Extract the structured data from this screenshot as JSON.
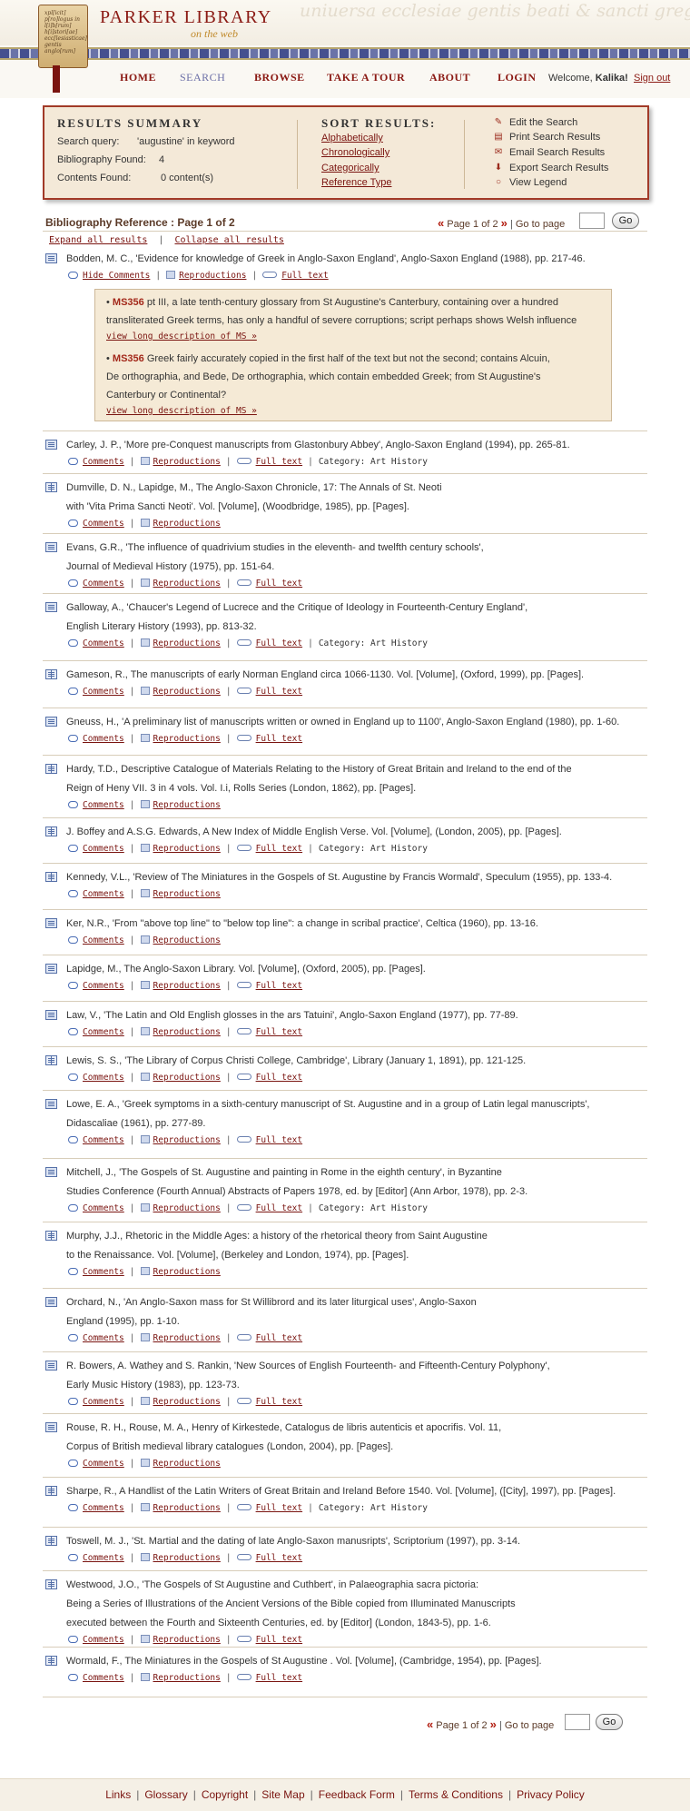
{
  "header": {
    "title": "PARKER LIBRARY",
    "subtitle": "on the web",
    "logo_text": "xpl[icit] p[ro]logus in l[i]b[rum] h[i]stori[ae] ecc[lesiasticae] gentis anglo[rum]",
    "background_script": "uniuersa ecclesiae gentis beati & sancti gregorii qui saeculis fecit scripsit sancta patrum dierum"
  },
  "nav": {
    "items": [
      "HOME",
      "SEARCH",
      "BROWSE",
      "TAKE A TOUR",
      "ABOUT",
      "LOGIN"
    ],
    "welcome_prefix": "Welcome,",
    "user": "Kalika!",
    "signout": "Sign out"
  },
  "summary": {
    "heading": "RESULTS SUMMARY",
    "query_label": "Search query:",
    "query_value": "'augustine' in keyword",
    "biblio_label": "Bibliography Found:",
    "biblio_value": "4",
    "contents_label": "Contents Found:",
    "contents_value": "0 content(s)",
    "sort_heading": "SORT RESULTS:",
    "sort_options": [
      "Alphabetically",
      "Chronologically",
      "Categorically",
      "Reference Type"
    ],
    "actions": [
      "Edit the Search",
      "Print Search Results",
      "Email Search Results",
      "Export Search Results",
      "View Legend"
    ]
  },
  "pager": {
    "title": "Bibliography Reference : Page 1 of 2",
    "page_text": "Page 1 of 2",
    "goto": "Go to page",
    "go": "Go",
    "prev": "«",
    "next": "»"
  },
  "expand": {
    "expand": "Expand all results",
    "collapse": "Collapse all results"
  },
  "link_labels": {
    "comments": "Comments",
    "hide_comments": "Hide Comments",
    "reproductions": "Reproductions",
    "fulltext": "Full text",
    "category_prefix": "Category:",
    "view_desc": "view long description of MS »"
  },
  "ms_items": [
    {
      "ms": "MS356",
      "text1": " pt III, a late tenth-century glossary from St Augustine's Canterbury, containing over a hundred",
      "text2": "transliterated Greek terms, has only a handful of severe corruptions; script perhaps shows Welsh influence"
    },
    {
      "ms": "MS356",
      "text1": " Greek fairly accurately copied in the first half of the text but not the second; contains Alcuin,",
      "text2": "De orthographia, and Bede, De orthographia, which contain embedded Greek; from St Augustine's",
      "text3": "Canterbury or Continental?"
    }
  ],
  "entries": [
    {
      "lines": [
        "Bodden, M. C.,  'Evidence for knowledge of Greek in Anglo-Saxon England', Anglo-Saxon England  (1988),  pp. 217-46."
      ],
      "fulltext": true,
      "category": "",
      "icon": "doc"
    },
    {
      "lines": [
        "Carley, J. P.,  'More pre-Conquest manuscripts from Glastonbury Abbey',  Anglo-Saxon  England  (1994),  pp. 265-81."
      ],
      "fulltext": true,
      "category": "Art History",
      "icon": "doc"
    },
    {
      "lines": [
        "Dumville, D. N.,  Lapidge, M.,  The Anglo-Saxon Chronicle, 17: The Annals of St. Neoti",
        "with 'Vita Prima Sancti Neoti'.   Vol. [Volume],  (Woodbridge,  1985),  pp. [Pages]."
      ],
      "fulltext": false,
      "category": "",
      "icon": "book"
    },
    {
      "lines": [
        "Evans, G.R.,  'The influence of quadrivium studies in the eleventh- and twelfth century schools',",
        "Journal of Medieval History  (1975),  pp. 151-64."
      ],
      "fulltext": true,
      "category": "",
      "icon": "doc"
    },
    {
      "lines": [
        "Galloway, A.,  'Chaucer's Legend of Lucrece and the Critique of Ideology in Fourteenth-Century  England',",
        "English Literary History  (1993),  pp. 813-32."
      ],
      "fulltext": true,
      "category": "Art History",
      "icon": "doc"
    },
    {
      "lines": [
        "Gameson, R.,  The manuscripts of early Norman England circa 1066-1130.   Vol. [Volume], (Oxford,  1999),  pp. [Pages]."
      ],
      "fulltext": true,
      "category": "",
      "icon": "book"
    },
    {
      "lines": [
        "Gneuss, H.,  'A preliminary list of manuscripts written or owned in England up to 1100',  Anglo-Saxon England  (1980),  pp. 1-60."
      ],
      "fulltext": true,
      "category": "",
      "icon": "doc"
    },
    {
      "lines": [
        "Hardy, T.D.,  Descriptive Catalogue of Materials Relating to the History of Great Britain and Ireland to the end of the",
        "Reign of Heny VII.   3 in 4 vols.   Vol. I.i,  Rolls Series  (London,  1862),  pp. [Pages]."
      ],
      "fulltext": false,
      "category": "",
      "icon": "book"
    },
    {
      "lines": [
        " J. Boffey and A.S.G. Edwards,  A New Index of Middle English Verse.   Vol. [Volume],  (London,  2005),  pp. [Pages]."
      ],
      "fulltext": true,
      "category": "Art History",
      "icon": "book"
    },
    {
      "lines": [
        "Kennedy, V.L.,  'Review of The Miniatures in the Gospels of St. Augustine by Francis Wormald', Speculum  (1955),  pp. 133-4."
      ],
      "fulltext": false,
      "category": "",
      "icon": "book"
    },
    {
      "lines": [
        "Ker, N.R.,  'From \"above top line\" to \"below top line\": a change in scribal practice',  Celtica  (1960),  pp. 13-16."
      ],
      "fulltext": false,
      "category": "",
      "icon": "doc"
    },
    {
      "lines": [
        "Lapidge, M.,  The Anglo-Saxon Library.   Vol. [Volume],  (Oxford,  2005),  pp. [Pages]."
      ],
      "fulltext": true,
      "category": "",
      "icon": "doc"
    },
    {
      "lines": [
        "Law, V.,  'The Latin and Old English glosses in the ars Tatuini',  Anglo-Saxon England  (1977),  pp. 77-89."
      ],
      "fulltext": true,
      "category": "",
      "icon": "doc"
    },
    {
      "lines": [
        "Lewis, S. S.,  'The Library of Corpus Christi College, Cambridge',  Library  (January 1, 1891),  pp. 121-125."
      ],
      "fulltext": true,
      "category": "",
      "icon": "book"
    },
    {
      "lines": [
        "Lowe, E. A.,  'Greek symptoms in a sixth-century manuscript of St. Augustine and in a group of Latin legal manuscripts',",
        "Didascaliae  (1961),  pp. 277-89."
      ],
      "fulltext": true,
      "category": "",
      "icon": "doc"
    },
    {
      "lines": [
        "Mitchell, J.,  'The Gospels of St. Augustine and painting in Rome in the eighth century',  in Byzantine",
        "Studies Conference (Fourth Annual) Abstracts of Papers 1978,  ed. by [Editor]  (Ann Arbor,  1978),  pp. 2-3."
      ],
      "fulltext": true,
      "category": "Art History",
      "icon": "doc"
    },
    {
      "lines": [
        "Murphy, J.J.,  Rhetoric in the Middle Ages: a history of the rhetorical theory from Saint Augustine",
        "to the Renaissance.   Vol. [Volume],  (Berkeley and London,  1974),  pp. [Pages]."
      ],
      "fulltext": false,
      "category": "",
      "icon": "book"
    },
    {
      "lines": [
        "Orchard, N.,  'An Anglo-Saxon mass for St Willibrord and its later liturgical uses',  Anglo-Saxon",
        "England  (1995),  pp. 1-10."
      ],
      "fulltext": true,
      "category": "",
      "icon": "doc"
    },
    {
      "lines": [
        "R. Bowers, A. Wathey and S. Rankin,  'New Sources of English Fourteenth- and Fifteenth-Century Polyphony',",
        "Early Music History  (1983),  pp. 123-73."
      ],
      "fulltext": true,
      "category": "",
      "icon": "doc"
    },
    {
      "lines": [
        "Rouse, R. H.,  Rouse, M. A.,  Henry of Kirkestede, Catalogus de libris autenticis et apocrifis.   Vol. 11,",
        "Corpus of British medieval library catalogues  (London,  2004),  pp. [Pages]."
      ],
      "fulltext": false,
      "category": "",
      "icon": "doc"
    },
    {
      "lines": [
        "Sharpe, R.,  A Handlist of the Latin Writers of Great Britain and Ireland Before 1540.   Vol. [Volume], ([City],  1997),  pp. [Pages]."
      ],
      "fulltext": true,
      "category": "Art History",
      "icon": "book"
    },
    {
      "lines": [
        "Toswell, M. J.,  'St. Martial and the dating of late Anglo-Saxon manusripts',  Scriptorium  (1997),  pp. 3-14."
      ],
      "fulltext": true,
      "category": "",
      "icon": "book"
    },
    {
      "lines": [
        "Westwood, J.O.,  'The Gospels of St Augustine and Cuthbert',  in Palaeographia sacra pictoria:",
        "Being a Series of Illustrations of the Ancient Versions of the Bible copied from Illuminated Manuscripts",
        "executed between the Fourth and Sixteenth Centuries,  ed. by [Editor]  (London,  1843-5),  pp. 1-6."
      ],
      "fulltext": true,
      "category": "",
      "icon": "book"
    },
    {
      "lines": [
        "Wormald, F.,  The Miniatures in the Gospels of St Augustine .   Vol. [Volume],  (Cambridge,  1954),  pp. [Pages]."
      ],
      "fulltext": true,
      "category": "",
      "icon": "book"
    }
  ],
  "footer": [
    "Links",
    "Glossary",
    "Copyright",
    "Site Map",
    "Feedback Form",
    "Terms & Conditions",
    "Privacy Policy"
  ],
  "colors": {
    "accent": "#8b1a14",
    "panel": "#f4e9d8",
    "border": "#a23a28"
  }
}
